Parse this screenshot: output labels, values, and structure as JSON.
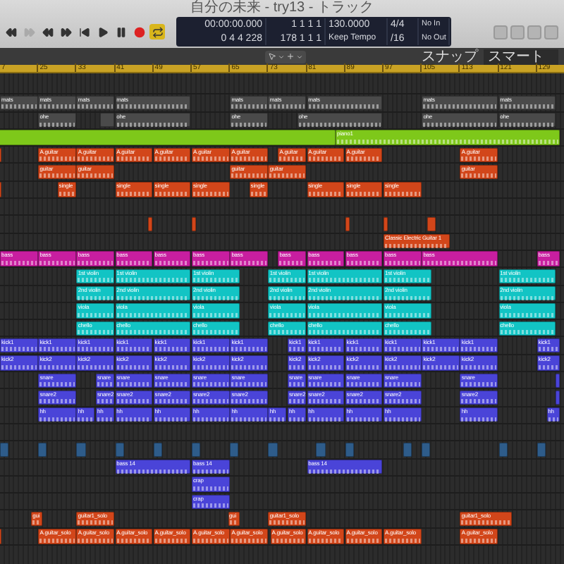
{
  "window": {
    "title": "自分の未来 - try13 - トラック"
  },
  "transport": {
    "cycle_on": true,
    "record_armed": false
  },
  "lcd": {
    "time": "00:00:00.000",
    "position": "1 1 1 1",
    "tempo": "130.0000",
    "signature": "4/4",
    "input": "No In",
    "locators_start": "0 4 4 228",
    "locators_end": "178 1 1 1",
    "tempo_mode": "Keep Tempo",
    "division": "/16",
    "output": "No Out"
  },
  "control_bar": {
    "snap_label": "スナップ",
    "snap_value": "スマート"
  },
  "ruler": [
    "7",
    "25",
    "33",
    "41",
    "49",
    "57",
    "65",
    "73",
    "81",
    "89",
    "97",
    "105",
    "113",
    "121",
    "129"
  ],
  "tracks": [
    {
      "kind": "empty"
    },
    {
      "kind": "lane",
      "color": "#4a4a4a",
      "regions": [
        {
          "kind": "clip",
          "label": "mats"
        },
        {
          "kind": "clip",
          "label": "mats"
        },
        {
          "kind": "clip",
          "label": "mats"
        },
        {
          "kind": "clip",
          "label": "mats"
        },
        {
          "kind": "clip",
          "label": "mats"
        },
        {
          "kind": "clip",
          "label": "mats"
        },
        {
          "kind": "clip",
          "label": "mats"
        },
        {
          "kind": "clip",
          "label": "mats"
        },
        {
          "kind": "clip",
          "label": "mats"
        }
      ]
    },
    {
      "kind": "lane",
      "color": "#4a4a4a",
      "regions": [
        {
          "kind": "clip",
          "label": "ohe"
        },
        {
          "kind": "sliver"
        },
        {
          "kind": "clip",
          "label": "ohe"
        },
        {
          "kind": "clip",
          "label": "ohe"
        },
        {
          "kind": "clip",
          "label": "ohe"
        },
        {
          "kind": "clip",
          "label": "ohe"
        },
        {
          "kind": "clip",
          "label": "ohe"
        }
      ]
    },
    {
      "kind": "lane",
      "color": "#7ec81a",
      "regions": [
        {
          "kind": "sliver"
        },
        {
          "kind": "clip",
          "label": "piano1"
        }
      ]
    },
    {
      "kind": "lane",
      "color": "#d2461a",
      "regions": [
        {
          "kind": "sliver"
        },
        {
          "kind": "clip",
          "label": "A.guitar"
        },
        {
          "kind": "clip",
          "label": "A.guitar"
        },
        {
          "kind": "clip",
          "label": "A.guitar"
        },
        {
          "kind": "clip",
          "label": "A.guitar"
        },
        {
          "kind": "clip",
          "label": "A.guitar"
        },
        {
          "kind": "clip",
          "label": "A.guitar"
        },
        {
          "kind": "clip",
          "label": "A.guitar"
        },
        {
          "kind": "clip",
          "label": "A.guitar"
        },
        {
          "kind": "clip",
          "label": "A.guitar"
        },
        {
          "kind": "clip",
          "label": "A.guitar"
        }
      ]
    },
    {
      "kind": "lane",
      "color": "#d2461a",
      "regions": [
        {
          "kind": "clip",
          "label": "guitar"
        },
        {
          "kind": "clip",
          "label": "guitar"
        },
        {
          "kind": "clip",
          "label": "guitar"
        },
        {
          "kind": "clip",
          "label": "guitar"
        },
        {
          "kind": "clip",
          "label": "guitar"
        }
      ]
    },
    {
      "kind": "lane",
      "color": "#d2461a",
      "regions": [
        {
          "kind": "sliver"
        },
        {
          "kind": "clip",
          "label": "single"
        },
        {
          "kind": "clip",
          "label": "single"
        },
        {
          "kind": "clip",
          "label": "single"
        },
        {
          "kind": "clip",
          "label": "single"
        },
        {
          "kind": "clip",
          "label": "single"
        },
        {
          "kind": "clip",
          "label": "single"
        },
        {
          "kind": "clip",
          "label": "single"
        },
        {
          "kind": "clip",
          "label": "single"
        }
      ]
    },
    {
      "kind": "empty"
    },
    {
      "kind": "lane",
      "color": "#d2461a",
      "regions": [
        {
          "kind": "sliver"
        },
        {
          "kind": "sliver"
        },
        {
          "kind": "sliver"
        },
        {
          "kind": "sliver"
        },
        {
          "kind": "sliver"
        }
      ]
    },
    {
      "kind": "lane",
      "color": "#d2461a",
      "regions": [
        {
          "kind": "clip",
          "label": "Classic Electric Guitar 1"
        }
      ]
    },
    {
      "kind": "lane",
      "color": "#c81ea0",
      "regions": [
        {
          "kind": "clip",
          "label": "bass"
        },
        {
          "kind": "clip",
          "label": "bass"
        },
        {
          "kind": "clip",
          "label": "bass"
        },
        {
          "kind": "clip",
          "label": "bass"
        },
        {
          "kind": "clip",
          "label": "bass"
        },
        {
          "kind": "clip",
          "label": "bass"
        },
        {
          "kind": "clip",
          "label": "bass"
        },
        {
          "kind": "clip",
          "label": "bass"
        },
        {
          "kind": "clip",
          "label": "bass"
        },
        {
          "kind": "clip",
          "label": "bass"
        },
        {
          "kind": "clip",
          "label": "bass"
        },
        {
          "kind": "clip",
          "label": "bass"
        },
        {
          "kind": "clip",
          "label": "bass"
        }
      ]
    },
    {
      "kind": "lane",
      "color": "#12c4c4",
      "regions": [
        {
          "kind": "clip",
          "label": "1st violin"
        },
        {
          "kind": "clip",
          "label": "1st violin"
        },
        {
          "kind": "clip",
          "label": "1st violin"
        },
        {
          "kind": "clip",
          "label": "1st violin"
        },
        {
          "kind": "clip",
          "label": "1st violin"
        },
        {
          "kind": "clip",
          "label": "1st violin"
        },
        {
          "kind": "clip",
          "label": "1st violin"
        }
      ]
    },
    {
      "kind": "lane",
      "color": "#12c4c4",
      "regions": [
        {
          "kind": "clip",
          "label": "2nd violin"
        },
        {
          "kind": "clip",
          "label": "2nd violin"
        },
        {
          "kind": "clip",
          "label": "2nd violin"
        },
        {
          "kind": "clip",
          "label": "2nd violin"
        },
        {
          "kind": "clip",
          "label": "2nd violin"
        },
        {
          "kind": "clip",
          "label": "2nd violin"
        },
        {
          "kind": "clip",
          "label": "2nd violin"
        }
      ]
    },
    {
      "kind": "lane",
      "color": "#12c4c4",
      "regions": [
        {
          "kind": "clip",
          "label": "viola"
        },
        {
          "kind": "clip",
          "label": "viola"
        },
        {
          "kind": "clip",
          "label": "viola"
        },
        {
          "kind": "clip",
          "label": "viola"
        },
        {
          "kind": "clip",
          "label": "viola"
        },
        {
          "kind": "clip",
          "label": "viola"
        },
        {
          "kind": "clip",
          "label": "viola"
        }
      ]
    },
    {
      "kind": "lane",
      "color": "#12c4c4",
      "regions": [
        {
          "kind": "clip",
          "label": "chello"
        },
        {
          "kind": "clip",
          "label": "chello"
        },
        {
          "kind": "clip",
          "label": "chello"
        },
        {
          "kind": "clip",
          "label": "chello"
        },
        {
          "kind": "clip",
          "label": "chello"
        },
        {
          "kind": "clip",
          "label": "chello"
        },
        {
          "kind": "clip",
          "label": "chello"
        }
      ]
    },
    {
      "kind": "lane",
      "color": "#4a44d8",
      "regions": [
        {
          "kind": "clip",
          "label": "kick1"
        },
        {
          "kind": "clip",
          "label": "kick1"
        },
        {
          "kind": "clip",
          "label": "kick1"
        },
        {
          "kind": "clip",
          "label": "kick1"
        },
        {
          "kind": "clip",
          "label": "kick1"
        },
        {
          "kind": "clip",
          "label": "kick1"
        },
        {
          "kind": "clip",
          "label": "kick1"
        },
        {
          "kind": "clip",
          "label": "kick1"
        },
        {
          "kind": "clip",
          "label": "kick1"
        },
        {
          "kind": "clip",
          "label": "kick1"
        },
        {
          "kind": "clip",
          "label": "kick1"
        },
        {
          "kind": "clip",
          "label": "kick1"
        },
        {
          "kind": "clip",
          "label": "kick1"
        },
        {
          "kind": "clip",
          "label": "kick1"
        }
      ]
    },
    {
      "kind": "lane",
      "color": "#4a44d8",
      "regions": [
        {
          "kind": "clip",
          "label": "kick2"
        },
        {
          "kind": "clip",
          "label": "kick2"
        },
        {
          "kind": "clip",
          "label": "kick2"
        },
        {
          "kind": "clip",
          "label": "kick2"
        },
        {
          "kind": "clip",
          "label": "kick2"
        },
        {
          "kind": "clip",
          "label": "kick2"
        },
        {
          "kind": "clip",
          "label": "kick2"
        },
        {
          "kind": "clip",
          "label": "kick2"
        },
        {
          "kind": "clip",
          "label": "kick2"
        },
        {
          "kind": "clip",
          "label": "kick2"
        },
        {
          "kind": "clip",
          "label": "kick2"
        },
        {
          "kind": "clip",
          "label": "kick2"
        },
        {
          "kind": "clip",
          "label": "kick2"
        },
        {
          "kind": "clip",
          "label": "kick2"
        }
      ]
    },
    {
      "kind": "lane",
      "color": "#4a44d8",
      "regions": [
        {
          "kind": "clip",
          "label": "snare"
        },
        {
          "kind": "clip",
          "label": "snare"
        },
        {
          "kind": "clip",
          "label": "snare"
        },
        {
          "kind": "clip",
          "label": "snare"
        },
        {
          "kind": "clip",
          "label": "snare"
        },
        {
          "kind": "clip",
          "label": "snare"
        },
        {
          "kind": "clip",
          "label": "snare"
        },
        {
          "kind": "clip",
          "label": "snare"
        },
        {
          "kind": "clip",
          "label": "snare"
        },
        {
          "kind": "clip",
          "label": "snare"
        },
        {
          "kind": "clip",
          "label": "snare"
        },
        {
          "kind": "sliver"
        }
      ]
    },
    {
      "kind": "lane",
      "color": "#4a44d8",
      "regions": [
        {
          "kind": "clip",
          "label": "snare2"
        },
        {
          "kind": "clip",
          "label": "snare2"
        },
        {
          "kind": "clip",
          "label": "snare2"
        },
        {
          "kind": "clip",
          "label": "snare2"
        },
        {
          "kind": "clip",
          "label": "snare2"
        },
        {
          "kind": "clip",
          "label": "snare2"
        },
        {
          "kind": "clip",
          "label": "snare2"
        },
        {
          "kind": "clip",
          "label": "snare2"
        },
        {
          "kind": "clip",
          "label": "snare2"
        },
        {
          "kind": "clip",
          "label": "snare2"
        },
        {
          "kind": "clip",
          "label": "snare2"
        },
        {
          "kind": "sliver"
        }
      ]
    },
    {
      "kind": "lane",
      "color": "#4a44d8",
      "regions": [
        {
          "kind": "clip",
          "label": "hh"
        },
        {
          "kind": "clip",
          "label": "hh"
        },
        {
          "kind": "clip",
          "label": "hh"
        },
        {
          "kind": "clip",
          "label": "hh"
        },
        {
          "kind": "clip",
          "label": "hh"
        },
        {
          "kind": "clip",
          "label": "hh"
        },
        {
          "kind": "clip",
          "label": "hh"
        },
        {
          "kind": "clip",
          "label": "hh"
        },
        {
          "kind": "clip",
          "label": "hh"
        },
        {
          "kind": "clip",
          "label": "hh"
        },
        {
          "kind": "clip",
          "label": "hh"
        },
        {
          "kind": "clip",
          "label": "hh"
        },
        {
          "kind": "clip",
          "label": "hh"
        },
        {
          "kind": "clip",
          "label": "hh"
        }
      ]
    },
    {
      "kind": "empty"
    },
    {
      "kind": "lane",
      "color": "#2e5c8a",
      "regions": [
        {
          "kind": "sliver"
        },
        {
          "kind": "sliver"
        },
        {
          "kind": "sliver"
        },
        {
          "kind": "sliver"
        },
        {
          "kind": "sliver"
        },
        {
          "kind": "sliver"
        },
        {
          "kind": "sliver"
        },
        {
          "kind": "sliver"
        },
        {
          "kind": "sliver"
        },
        {
          "kind": "sliver"
        },
        {
          "kind": "sliver"
        },
        {
          "kind": "sliver"
        },
        {
          "kind": "sliver"
        },
        {
          "kind": "sliver"
        }
      ]
    },
    {
      "kind": "lane",
      "color": "#4a44d8",
      "regions": [
        {
          "kind": "clip",
          "label": "bass 14"
        },
        {
          "kind": "clip",
          "label": "bass 14"
        },
        {
          "kind": "clip",
          "label": "bass 14"
        }
      ]
    },
    {
      "kind": "lane",
      "color": "#4a44d8",
      "regions": [
        {
          "kind": "clip",
          "label": "crap"
        }
      ]
    },
    {
      "kind": "lane",
      "color": "#4a44d8",
      "regions": [
        {
          "kind": "clip",
          "label": "crap"
        }
      ]
    },
    {
      "kind": "lane",
      "color": "#d2461a",
      "regions": [
        {
          "kind": "clip",
          "label": "gui"
        },
        {
          "kind": "clip",
          "label": "guitar1_solo"
        },
        {
          "kind": "clip",
          "label": "gui"
        },
        {
          "kind": "clip",
          "label": "guitar1_solo"
        },
        {
          "kind": "clip",
          "label": "guitar1_solo"
        }
      ]
    },
    {
      "kind": "lane",
      "color": "#d2461a",
      "regions": [
        {
          "kind": "sliver"
        },
        {
          "kind": "clip",
          "label": "A.guitar_solo"
        },
        {
          "kind": "clip",
          "label": "A.guitar_solo"
        },
        {
          "kind": "clip",
          "label": "A.guitar_solo"
        },
        {
          "kind": "clip",
          "label": "A.guitar_solo"
        },
        {
          "kind": "clip",
          "label": "A.guitar_solo"
        },
        {
          "kind": "clip",
          "label": "A.guitar_solo"
        },
        {
          "kind": "clip",
          "label": "A.guitar_solo"
        },
        {
          "kind": "clip",
          "label": "A.guitar_solo"
        },
        {
          "kind": "clip",
          "label": "A.guitar_solo"
        },
        {
          "kind": "clip",
          "label": "A.guitar_solo"
        },
        {
          "kind": "clip",
          "label": "A.guitar_solo"
        }
      ]
    }
  ]
}
